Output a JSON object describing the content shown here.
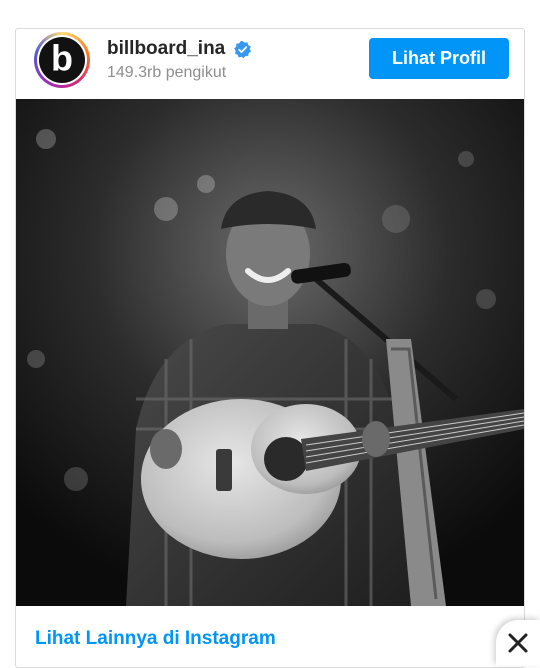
{
  "profile": {
    "username": "billboard_ina",
    "followers": "149.3rb pengikut",
    "avatar_label": "billboard",
    "verified_icon": "verified-badge-icon",
    "view_profile_label": "Lihat Profil"
  },
  "post": {
    "image_alt": "black-and-white photo of a smiling guitarist singing at a microphone on stage"
  },
  "footer": {
    "more_link_label": "Lihat Lainnya di Instagram"
  },
  "close": {
    "icon": "close-icon"
  },
  "colors": {
    "accent": "#0095f6",
    "border": "#dbdbdb",
    "muted": "#8e8e8e",
    "text": "#262626"
  }
}
